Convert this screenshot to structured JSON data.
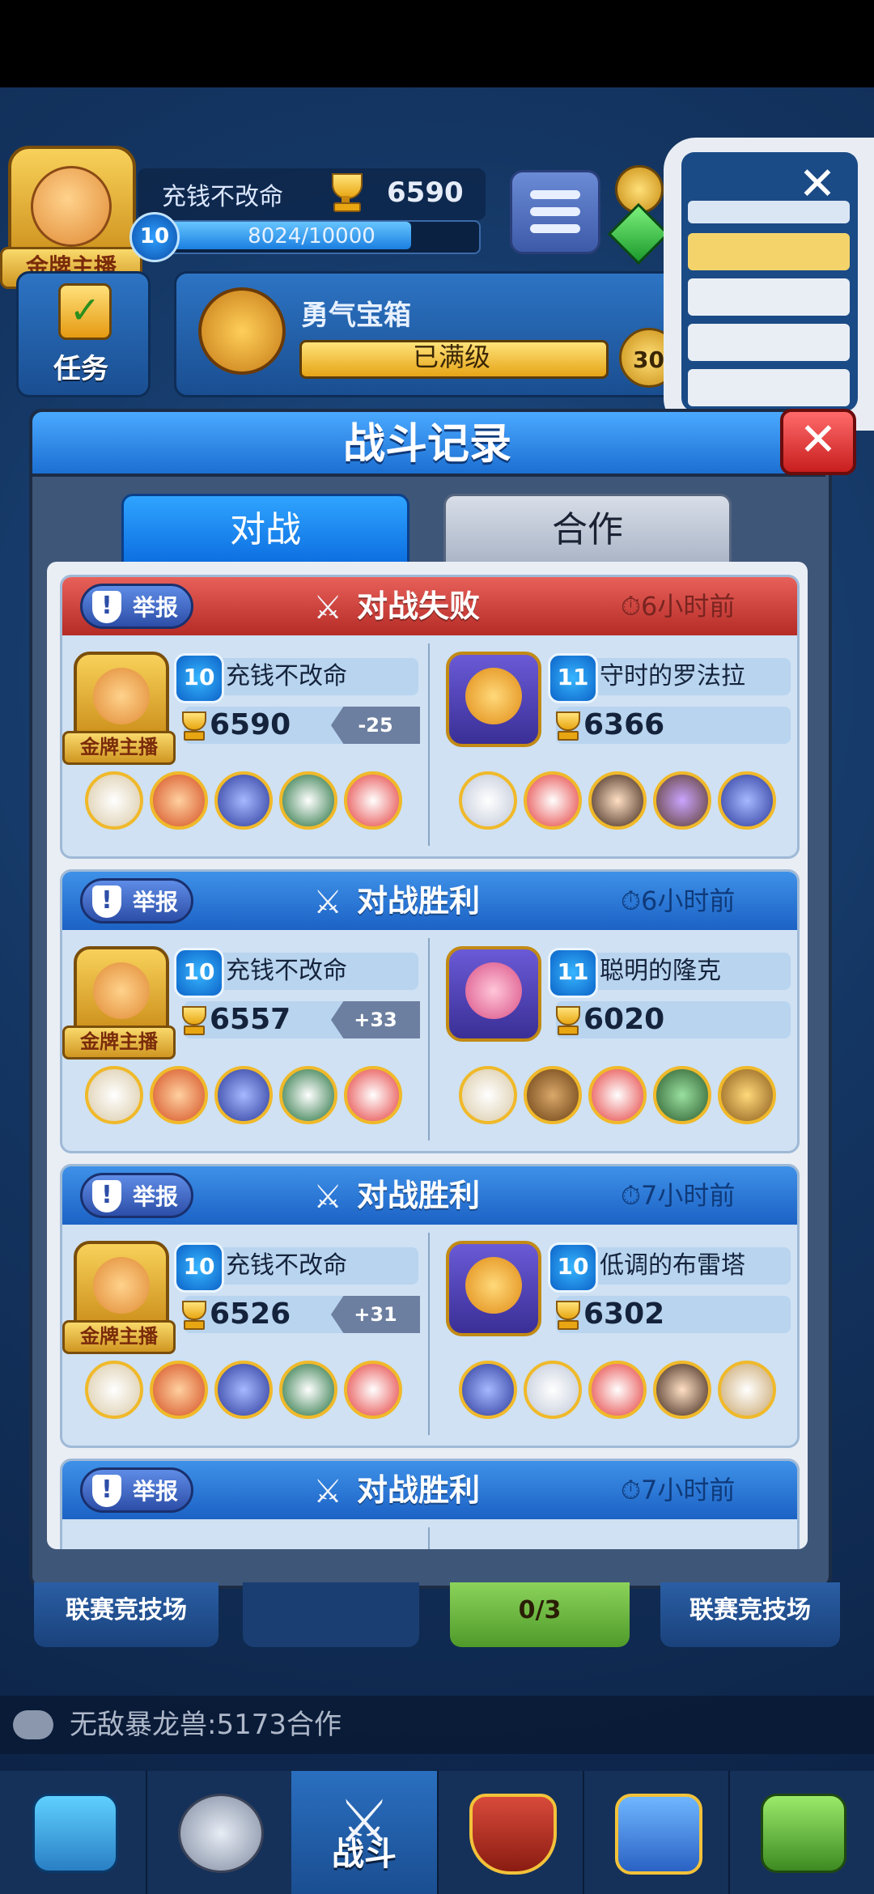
{
  "colors": {
    "lose_header": "#c7413b",
    "win_header": "#2a76d6",
    "dialog_title": "#1c6fd2",
    "trophy": "#f2b21a"
  },
  "player": {
    "name": "充钱不改命",
    "trophies": "6590",
    "level": "10",
    "xp": "8024/10000",
    "xp_fraction": 0.8024,
    "badge": "金牌主播"
  },
  "hud": {
    "task_label": "任务",
    "chest_title": "勇气宝箱",
    "chest_status": "已满级",
    "coin_partial": "30",
    "pip_close": "✕"
  },
  "dialog": {
    "title": "战斗记录",
    "close": "✕",
    "tabs": [
      {
        "label": "对战"
      },
      {
        "label": "合作"
      }
    ]
  },
  "records": [
    {
      "report": "举报",
      "result": "对战失败",
      "outcome": "lose",
      "time": "6小时前",
      "me": {
        "level": "10",
        "name": "充钱不改命",
        "trophies": "6590",
        "delta": "-25",
        "badge": "金牌主播"
      },
      "opponent": {
        "level": "11",
        "name": "守时的罗法拉",
        "trophies": "6366"
      }
    },
    {
      "report": "举报",
      "result": "对战胜利",
      "outcome": "win",
      "time": "6小时前",
      "me": {
        "level": "10",
        "name": "充钱不改命",
        "trophies": "6557",
        "delta": "+33",
        "badge": "金牌主播"
      },
      "opponent": {
        "level": "11",
        "name": "聪明的隆克",
        "trophies": "6020"
      }
    },
    {
      "report": "举报",
      "result": "对战胜利",
      "outcome": "win",
      "time": "7小时前",
      "me": {
        "level": "10",
        "name": "充钱不改命",
        "trophies": "6526",
        "delta": "+31",
        "badge": "金牌主播"
      },
      "opponent": {
        "level": "10",
        "name": "低调的布雷塔",
        "trophies": "6302"
      }
    },
    {
      "report": "举报",
      "result": "对战胜利",
      "outcome": "win",
      "time": "7小时前"
    }
  ],
  "background_cards": {
    "left": "联赛竞技场",
    "center_progress": "0/3",
    "right": "联赛竞技场"
  },
  "chat": {
    "message": "无敌暴龙兽:5173合作"
  },
  "nav": {
    "items": [
      {
        "name": "treasure"
      },
      {
        "name": "hero"
      },
      {
        "name": "battle",
        "label": "战斗"
      },
      {
        "name": "clan"
      },
      {
        "name": "social"
      },
      {
        "name": "garden"
      }
    ]
  }
}
